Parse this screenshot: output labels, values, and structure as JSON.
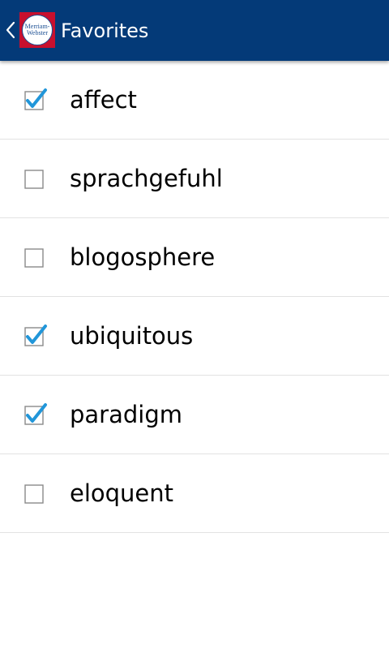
{
  "header": {
    "title": "Favorites",
    "back_icon": "chevron-left-icon",
    "logo_text_line1": "Merriam-",
    "logo_text_line2": "Webster",
    "background_color": "#043a78"
  },
  "favorites": [
    {
      "word": "affect",
      "checked": true
    },
    {
      "word": "sprachgefuhl",
      "checked": false
    },
    {
      "word": "blogosphere",
      "checked": false
    },
    {
      "word": "ubiquitous",
      "checked": true
    },
    {
      "word": "paradigm",
      "checked": true
    },
    {
      "word": "eloquent",
      "checked": false
    }
  ],
  "colors": {
    "checkmark": "#2196d9",
    "checkbox_border": "#8a8a8a",
    "divider": "#e2e2e2"
  }
}
